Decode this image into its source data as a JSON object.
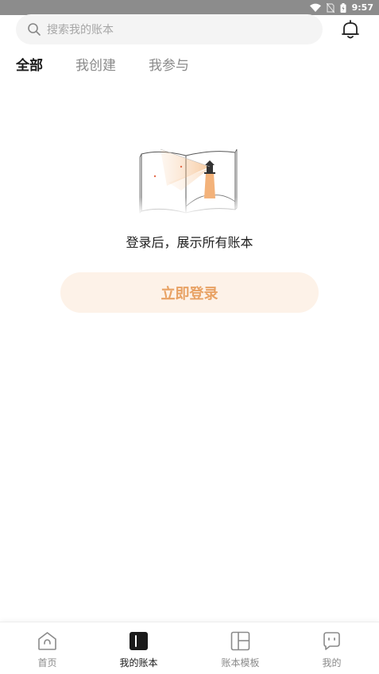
{
  "status_bar": {
    "time": "9:57"
  },
  "search": {
    "placeholder": "搜索我的账本"
  },
  "tabs": [
    {
      "label": "全部",
      "active": true
    },
    {
      "label": "我创建",
      "active": false
    },
    {
      "label": "我参与",
      "active": false
    }
  ],
  "empty_state": {
    "message": "登录后，展示所有账本",
    "button_label": "立即登录"
  },
  "bottom_nav": [
    {
      "label": "首页",
      "icon": "home-icon",
      "active": false
    },
    {
      "label": "我的账本",
      "icon": "ledger-icon",
      "active": true
    },
    {
      "label": "账本模板",
      "icon": "template-icon",
      "active": false
    },
    {
      "label": "我的",
      "icon": "profile-icon",
      "active": false
    }
  ],
  "colors": {
    "accent": "#f0a055",
    "button_bg": "#fdf2e8",
    "button_text": "#e8a264",
    "status_bar_bg": "#8c8c8c"
  }
}
